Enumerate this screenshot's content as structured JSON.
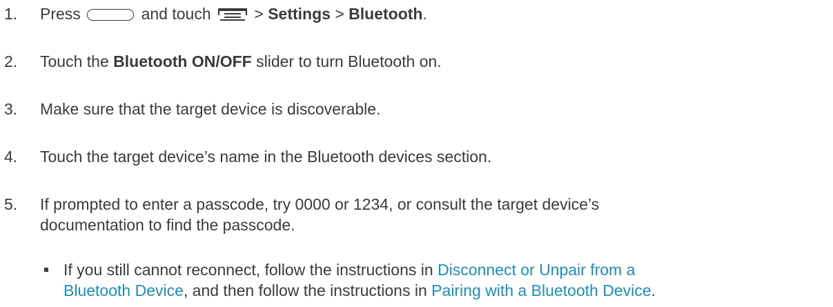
{
  "steps": [
    {
      "number": "1.",
      "press": "Press",
      "and_touch": "and touch",
      "sep1": ">",
      "settings": "Settings",
      "sep2": ">",
      "bluetooth": "Bluetooth",
      "end": "."
    },
    {
      "number": "2.",
      "pre": "Touch the",
      "bold": "Bluetooth ON/OFF",
      "post": "slider to turn Bluetooth on."
    },
    {
      "number": "3.",
      "text": "Make sure that the target device is discoverable."
    },
    {
      "number": "4.",
      "text": "Touch the target device’s name in the Bluetooth devices section."
    },
    {
      "number": "5.",
      "line1": "If prompted to enter a passcode, try 0000 or 1234, or consult the target device’s",
      "line2": "documentation to find the passcode."
    }
  ],
  "bullet": {
    "pre": "If you still cannot reconnect, follow the instructions in",
    "link1_line1": "Disconnect or Unpair from a",
    "link1_line2": "Bluetooth Device",
    "mid": ", and then follow the instructions in",
    "link2": "Pairing with a Bluetooth Device",
    "end": "."
  },
  "icons": {
    "home_key": "home-key-icon",
    "menu_key": "menu-key-icon"
  },
  "colors": {
    "text": "#3a3a3a",
    "link": "#1a8fb8"
  }
}
